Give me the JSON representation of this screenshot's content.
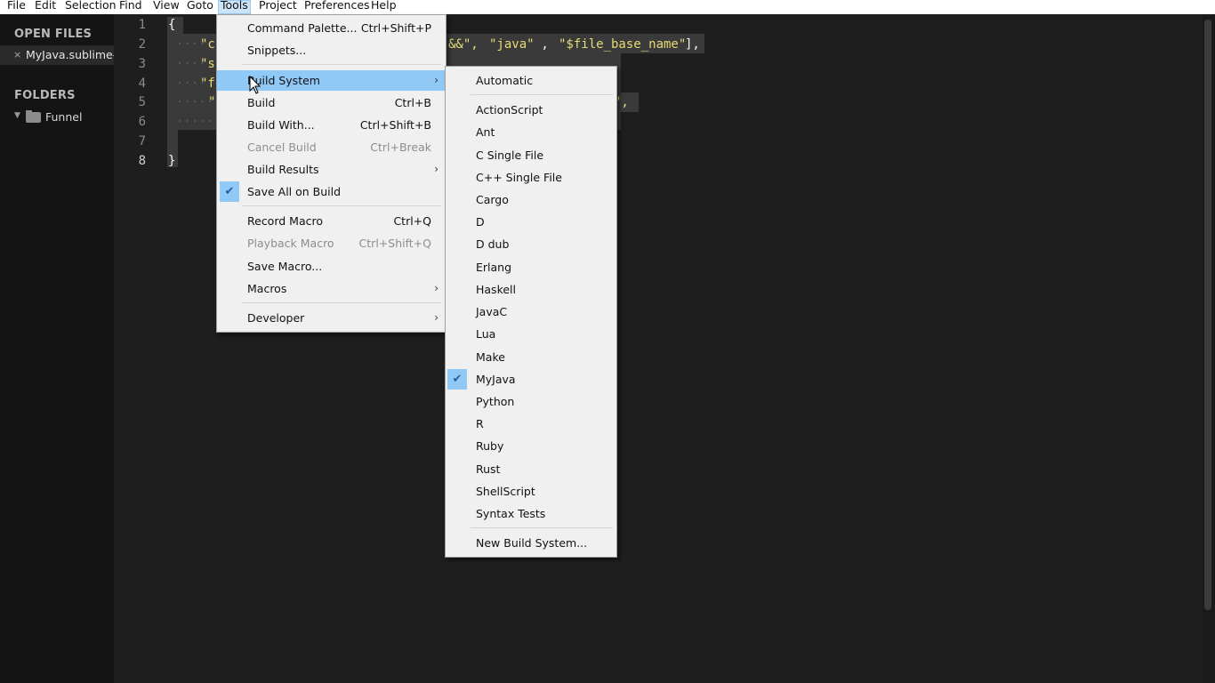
{
  "menubar": {
    "items": [
      {
        "label": "File"
      },
      {
        "label": "Edit"
      },
      {
        "label": "Selection"
      },
      {
        "label": "Find"
      },
      {
        "label": "View"
      },
      {
        "label": "Goto"
      },
      {
        "label": "Tools"
      },
      {
        "label": "Project"
      },
      {
        "label": "Preferences"
      },
      {
        "label": "Help"
      }
    ],
    "active": "Tools"
  },
  "sidebar": {
    "open_files_heading": "OPEN FILES",
    "open_file": {
      "close_glyph": "×",
      "name": "MyJava.sublime-build"
    },
    "folders_heading": "FOLDERS",
    "folder": {
      "expand_glyph": "▼",
      "name": "Funnel"
    }
  },
  "editor": {
    "line_numbers": [
      "1",
      "2",
      "3",
      "4",
      "5",
      "6",
      "7",
      "8"
    ],
    "code": {
      "open_brace": "{",
      "line2_start": "\"c",
      "line2_tail_1": "&&\", ",
      "line2_java": "\"java\"",
      "line2_tail_2": " ,",
      "line2_basename": "\"$file_base_name\"",
      "line2_end": "],",
      "line3_start": "\"s",
      "line4_start": "\"f",
      "line5_start": "\"",
      "line5_end": "\",",
      "close_brace": "}"
    }
  },
  "tools_menu": {
    "items": [
      {
        "label": "Command Palette...",
        "shortcut": "Ctrl+Shift+P"
      },
      {
        "label": "Snippets..."
      },
      {
        "label": "Build System",
        "arrow": "›"
      },
      {
        "label": "Build",
        "shortcut": "Ctrl+B"
      },
      {
        "label": "Build With...",
        "shortcut": "Ctrl+Shift+B"
      },
      {
        "label": "Cancel Build",
        "shortcut": "Ctrl+Break"
      },
      {
        "label": "Build Results",
        "arrow": "›"
      },
      {
        "label": "Save All on Build",
        "check": "✔"
      },
      {
        "label": "Record Macro",
        "shortcut": "Ctrl+Q"
      },
      {
        "label": "Playback Macro",
        "shortcut": "Ctrl+Shift+Q"
      },
      {
        "label": "Save Macro..."
      },
      {
        "label": "Macros",
        "arrow": "›"
      },
      {
        "label": "Developer",
        "arrow": "›"
      }
    ]
  },
  "build_system_menu": {
    "items": [
      {
        "label": "Automatic"
      },
      {
        "label": "ActionScript"
      },
      {
        "label": "Ant"
      },
      {
        "label": "C Single File"
      },
      {
        "label": "C++ Single File"
      },
      {
        "label": "Cargo"
      },
      {
        "label": "D"
      },
      {
        "label": "D dub"
      },
      {
        "label": "Erlang"
      },
      {
        "label": "Haskell"
      },
      {
        "label": "JavaC"
      },
      {
        "label": "Lua"
      },
      {
        "label": "Make"
      },
      {
        "label": "MyJava",
        "check": "✔"
      },
      {
        "label": "Python"
      },
      {
        "label": "R"
      },
      {
        "label": "Ruby"
      },
      {
        "label": "Rust"
      },
      {
        "label": "ShellScript"
      },
      {
        "label": "Syntax Tests"
      },
      {
        "label": "New Build System..."
      }
    ]
  },
  "colors": {
    "menu_highlight": "#90c8f6",
    "string_yellow": "#e6db74",
    "editor_bg": "#1e1e1e",
    "sidebar_bg": "#141414"
  }
}
